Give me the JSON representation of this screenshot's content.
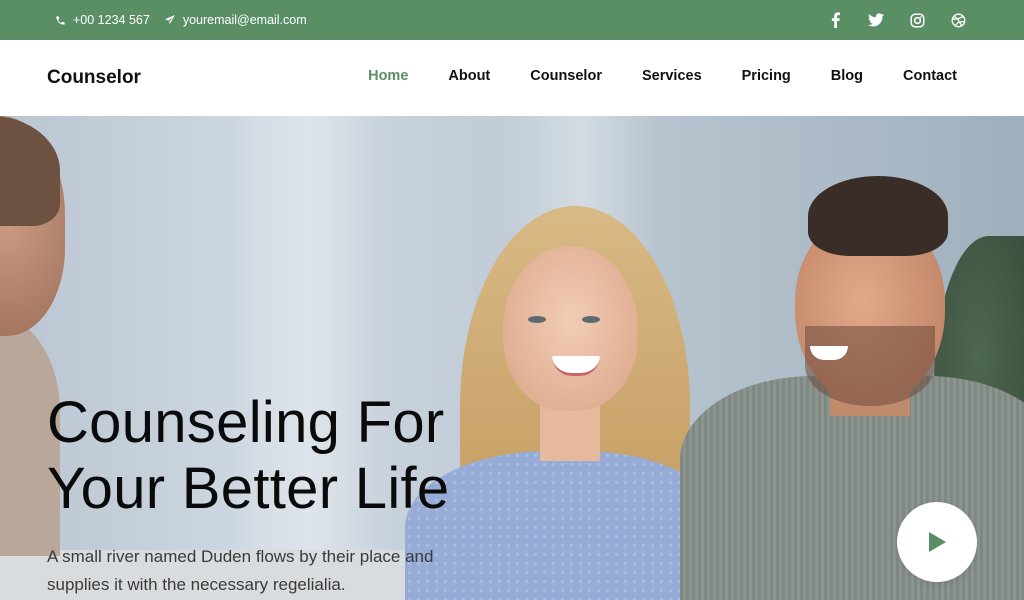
{
  "topbar": {
    "phone": "+00 1234 567",
    "email": "youremail@email.com",
    "social": [
      "facebook-icon",
      "twitter-icon",
      "instagram-icon",
      "dribbble-icon"
    ]
  },
  "nav": {
    "brand": "Counselor",
    "items": [
      {
        "label": "Home",
        "active": true
      },
      {
        "label": "About"
      },
      {
        "label": "Counselor"
      },
      {
        "label": "Services"
      },
      {
        "label": "Pricing"
      },
      {
        "label": "Blog"
      },
      {
        "label": "Contact"
      }
    ]
  },
  "hero": {
    "title_line1": "Counseling For",
    "title_line2": "Your Better Life",
    "text_line1": "A small river named Duden flows by their place and",
    "text_line2": "supplies it with the necessary regelialia."
  },
  "colors": {
    "accent": "#5a8f65",
    "text": "#111111"
  }
}
